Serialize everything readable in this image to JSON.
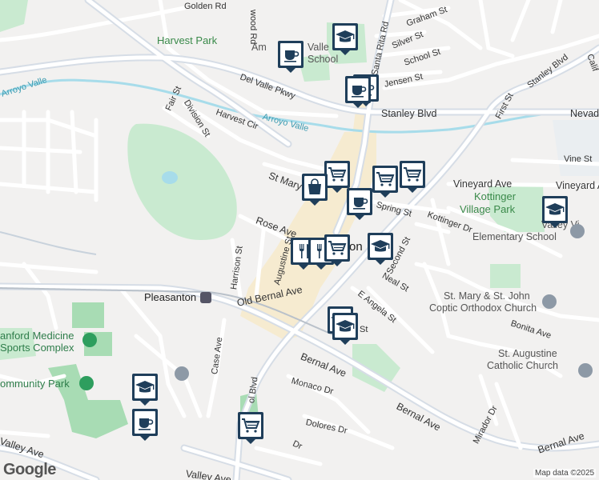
{
  "map": {
    "streets": {
      "golden_rd": "Golden Rd",
      "wood_rd": "wood Rd",
      "graham_st": "Graham St",
      "silver_st": "Silver St",
      "school_st": "School St",
      "santa_rita_rd": "Santa Rita Rd",
      "jensen_st": "Jensen St",
      "stanley_blvd_ne": "Stanley Blvd",
      "calif": "Calif",
      "del_valle_pkwy": "Del Valle Pkwy",
      "fair_st": "Fair St",
      "harvest_cir": "Harvest Cir",
      "division_st": "Division St",
      "stanley_blvd": "Stanley Blvd",
      "first_st": "First St",
      "nevada": "Nevad",
      "vine_st": "Vine St",
      "st_mary": "St Mary",
      "vineyard_ave": "Vineyard Ave",
      "spring_st": "Spring St",
      "kottinger_dr": "Kottinger Dr",
      "rose_ave": "Rose Ave",
      "augustine_st": "Augustine St",
      "second_st": "Second St",
      "harrison_st": "Harrison St",
      "neal_st": "Neal St",
      "old_bernal_ave": "Old Bernal Ave",
      "e_angela_st": "E Angela St",
      "angela_st_frag": "St",
      "bonita_ave": "Bonita Ave",
      "case_ave": "Case Ave",
      "bernal_ave_1": "Bernal Ave",
      "bernal_ave_2": "Bernal Ave",
      "bernal_ave_3": "Bernal Ave",
      "monaco_dr": "Monaco Dr",
      "dolores_dr": "Dolores Dr",
      "mirador_dr": "Mirador Dr",
      "valley_ave_w": "Valley Ave",
      "valley_ave_s": "Valley Ave",
      "blvd": "ol Blvd",
      "dr_frag": "Dr"
    },
    "places": {
      "harvest_park": "Harvest Park",
      "arroyo_valle_w": "Arroyo Valle",
      "arroyo_valle": "Arroyo Valle",
      "amador_valley_1": "Am",
      "amador_valley_2": "Valle",
      "amador_school": "School",
      "kottinger_village_park_1": "Kottinger",
      "kottinger_village_park_2": "Village Park",
      "valley_view_1": "Valley Vi",
      "valley_view_2": "Elementary School",
      "pleasanton": "Pleasanton",
      "pleasanton_city": "on",
      "st_mary_st_john_1": "St. Mary & St. John",
      "st_mary_st_john_2": "Coptic Orthodox Church",
      "st_augustine_1": "St. Augustine",
      "st_augustine_2": "Catholic Church",
      "stanford_1": "anford Medicine",
      "stanford_2": "Sports Complex",
      "community_park": "ommunity Park"
    },
    "footer": {
      "google": "Google",
      "attribution": "Map data ©2025"
    },
    "colors": {
      "background": "#f2f1f0",
      "road": "#ffffff",
      "road_outline": "#d9d9d9",
      "arterial": "#d6dde6",
      "park": "#c9ead0",
      "park_dark": "#a8dcb4",
      "water": "#a7dcea",
      "downtown": "#f6ebd0",
      "marker": "#1f3e5a",
      "marker_bg": "#ffffff",
      "poi_gray": "#8d99a6"
    },
    "markers": [
      {
        "type": "coffee-icon"
      },
      {
        "type": "school-icon"
      },
      {
        "type": "coffee-icon"
      },
      {
        "type": "coffee-icon"
      },
      {
        "type": "shopping-cart-icon"
      },
      {
        "type": "shopping-cart-icon"
      },
      {
        "type": "shopping-cart-icon"
      },
      {
        "type": "shopping-bag-icon"
      },
      {
        "type": "coffee-icon"
      },
      {
        "type": "school-icon"
      },
      {
        "type": "restaurant-icon"
      },
      {
        "type": "restaurant-icon"
      },
      {
        "type": "shopping-cart-icon"
      },
      {
        "type": "school-icon"
      },
      {
        "type": "school-icon"
      },
      {
        "type": "school-icon"
      },
      {
        "type": "school-icon"
      },
      {
        "type": "coffee-icon"
      },
      {
        "type": "shopping-cart-icon"
      }
    ]
  }
}
